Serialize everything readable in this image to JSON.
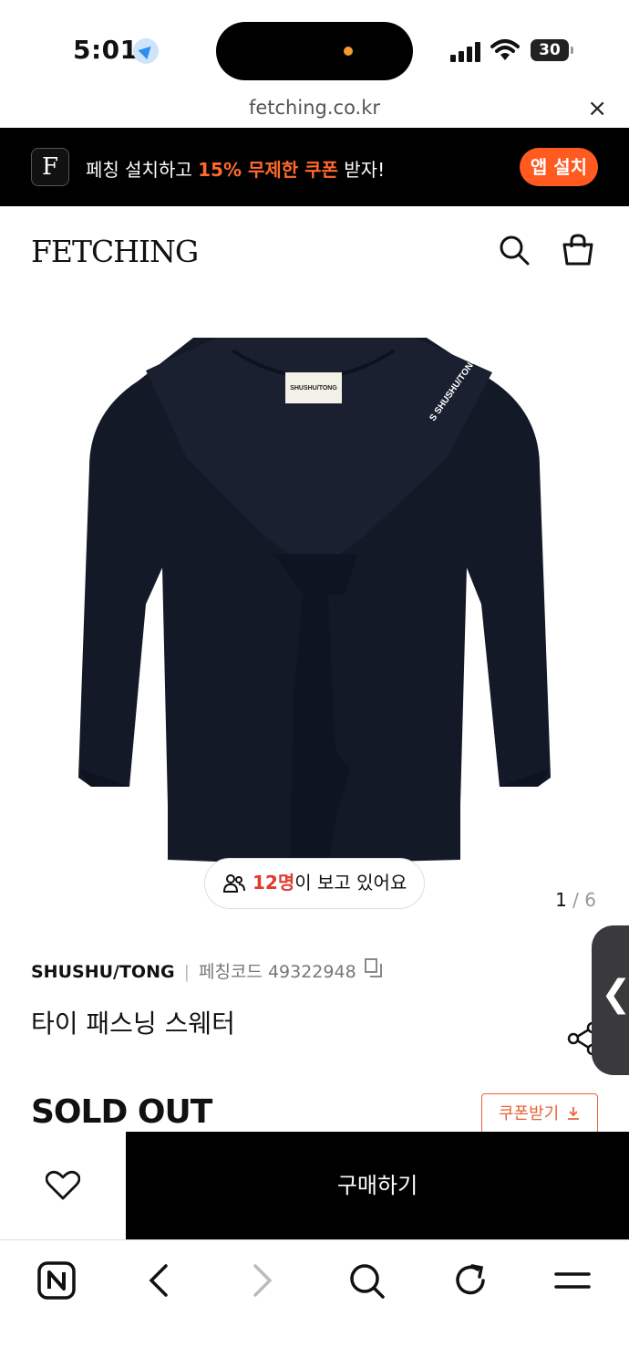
{
  "status_bar": {
    "time": "5:01",
    "battery": "30"
  },
  "browser": {
    "url": "fetching.co.kr",
    "close_glyph": "×"
  },
  "app_banner": {
    "logo_letter": "F",
    "message_prefix": "페칭 설치하고 ",
    "message_highlight": "15% 무제한 쿠폰",
    "message_suffix": " 받자!",
    "install_label": "앱 설치",
    "accent_color": "#ff5a1f"
  },
  "header": {
    "brand": "FETCHING",
    "icons": [
      "search-icon",
      "shopping-bag-icon"
    ]
  },
  "gallery": {
    "current": "1",
    "separator": " / ",
    "total": "6",
    "label_logo": "SHUSHU/TONG"
  },
  "viewers": {
    "count_text": "12명",
    "suffix": "이 보고 있어요"
  },
  "product": {
    "brand": "SHUSHU/TONG",
    "separator": "|",
    "code_label": "페칭코드 49322948",
    "name": "타이 패스닝 스웨터",
    "status": "SOLD OUT",
    "coupon_label": "쿠폰받기"
  },
  "purchase_bar": {
    "buy_label": "구매하기"
  },
  "toolbar": {
    "icons": [
      "naver-home-icon",
      "back-icon",
      "forward-icon",
      "search-icon",
      "refresh-icon",
      "menu-icon"
    ]
  }
}
